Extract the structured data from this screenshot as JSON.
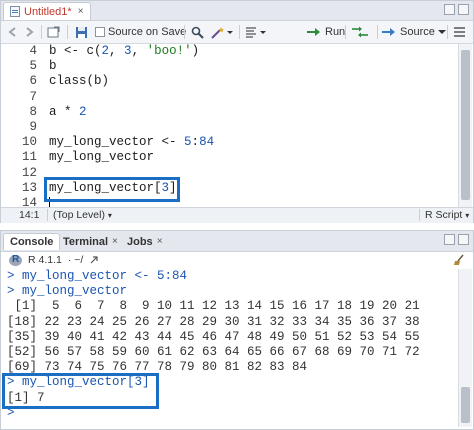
{
  "editor": {
    "tab_title": "Untitled1*",
    "tab_close": "×",
    "toolbar": {
      "source_on_save": "Source on Save",
      "run": "Run",
      "source": "Source"
    },
    "lines": [
      {
        "n": "4",
        "tokens": [
          {
            "t": "b <- c(",
            "c": "plain"
          },
          {
            "t": "2",
            "c": "num"
          },
          {
            "t": ", ",
            "c": "plain"
          },
          {
            "t": "3",
            "c": "num"
          },
          {
            "t": ", ",
            "c": "plain"
          },
          {
            "t": "'boo!'",
            "c": "str"
          },
          {
            "t": ")",
            "c": "plain"
          }
        ]
      },
      {
        "n": "5",
        "tokens": [
          {
            "t": "b",
            "c": "plain"
          }
        ]
      },
      {
        "n": "6",
        "tokens": [
          {
            "t": "class(b)",
            "c": "plain"
          }
        ]
      },
      {
        "n": "7",
        "tokens": []
      },
      {
        "n": "8",
        "tokens": [
          {
            "t": "a * ",
            "c": "plain"
          },
          {
            "t": "2",
            "c": "num"
          }
        ]
      },
      {
        "n": "9",
        "tokens": []
      },
      {
        "n": "10",
        "tokens": [
          {
            "t": "my_long_vector <- ",
            "c": "plain"
          },
          {
            "t": "5",
            "c": "num"
          },
          {
            "t": ":",
            "c": "plain"
          },
          {
            "t": "84",
            "c": "num"
          }
        ]
      },
      {
        "n": "11",
        "tokens": [
          {
            "t": "my_long_vector",
            "c": "plain"
          }
        ]
      },
      {
        "n": "12",
        "tokens": []
      },
      {
        "n": "13",
        "tokens": [
          {
            "t": "my_long_vector[",
            "c": "plain"
          },
          {
            "t": "3",
            "c": "num"
          },
          {
            "t": "]",
            "c": "plain"
          }
        ]
      },
      {
        "n": "14",
        "tokens": []
      }
    ],
    "status": {
      "position": "14:1",
      "scope": "(Top Level)",
      "filetype": "R Script"
    }
  },
  "console": {
    "tabs": [
      {
        "label": "Console",
        "close": ""
      },
      {
        "label": "Terminal",
        "close": "×"
      },
      {
        "label": "Jobs",
        "close": "×"
      }
    ],
    "r_version": "R 4.1.1",
    "working_dir": "· ~/",
    "lines": [
      {
        "text": "> my_long_vector <- 5:84",
        "kind": "cmd"
      },
      {
        "text": "> my_long_vector",
        "kind": "cmd"
      },
      {
        "text": " [1]  5  6  7  8  9 10 11 12 13 14 15 16 17 18 19 20 21",
        "kind": "out"
      },
      {
        "text": "[18] 22 23 24 25 26 27 28 29 30 31 32 33 34 35 36 37 38",
        "kind": "out"
      },
      {
        "text": "[35] 39 40 41 42 43 44 45 46 47 48 49 50 51 52 53 54 55",
        "kind": "out"
      },
      {
        "text": "[52] 56 57 58 59 60 61 62 63 64 65 66 67 68 69 70 71 72",
        "kind": "out"
      },
      {
        "text": "[69] 73 74 75 76 77 78 79 80 81 82 83 84",
        "kind": "out"
      },
      {
        "text": "> my_long_vector[3]",
        "kind": "cmd"
      },
      {
        "text": "[1] 7",
        "kind": "out"
      },
      {
        "text": ">",
        "kind": "cmd"
      }
    ]
  },
  "colors": {
    "highlight": "#1a6fc4",
    "number": "#1a55b0",
    "string": "#1f7a1f",
    "modified_title": "#c0392b"
  }
}
